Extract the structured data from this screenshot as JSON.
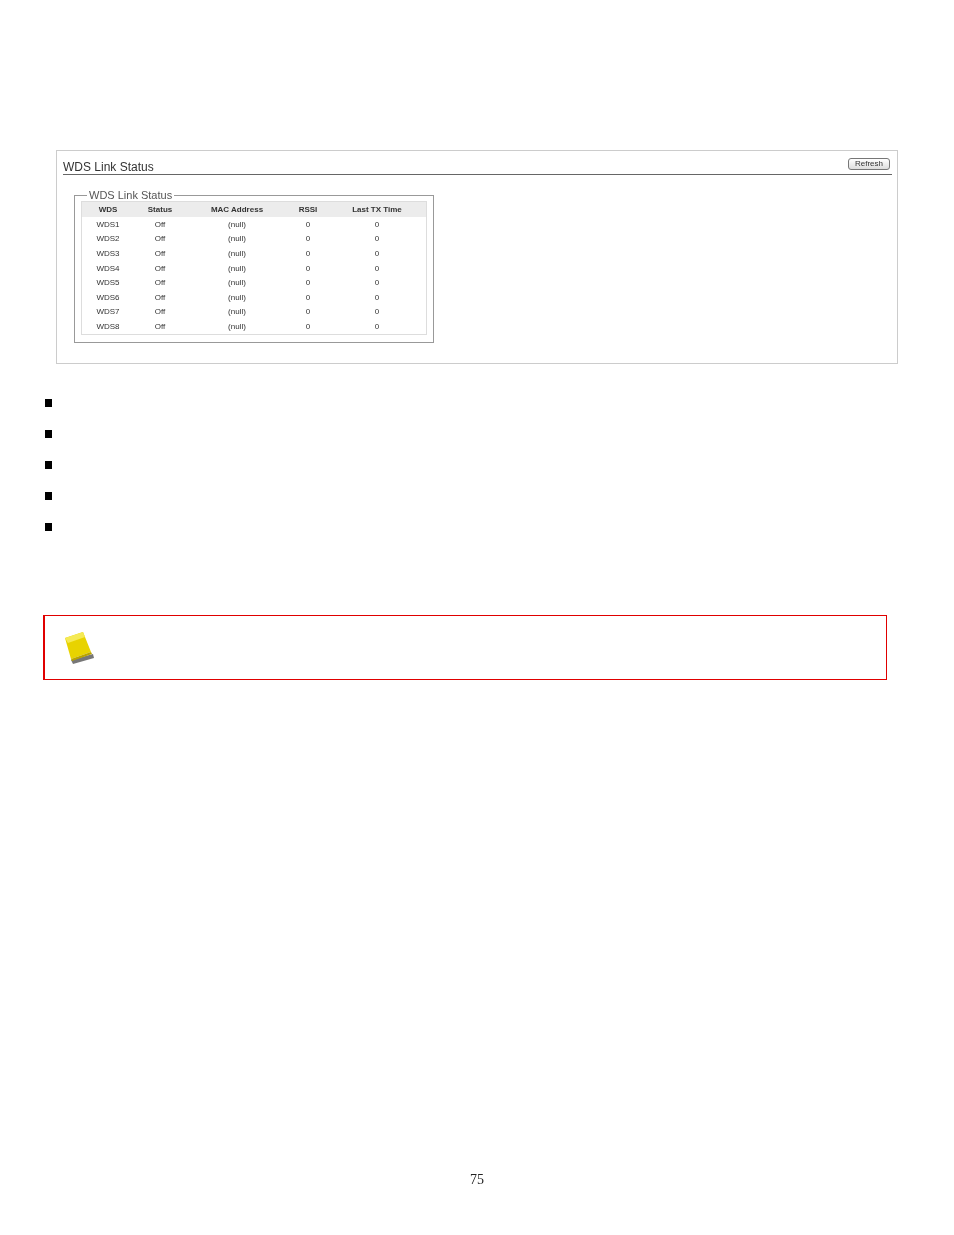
{
  "panel": {
    "title": "WDS Link Status",
    "refresh_button": "Refresh",
    "group": {
      "legend": "WDS Link Status",
      "table": {
        "columns": [
          "WDS",
          "Status",
          "MAC Address",
          "RSSI",
          "Last TX Time"
        ],
        "rows": [
          [
            "WDS1",
            "Off",
            "(null)",
            "0",
            "0"
          ],
          [
            "WDS2",
            "Off",
            "(null)",
            "0",
            "0"
          ],
          [
            "WDS3",
            "Off",
            "(null)",
            "0",
            "0"
          ],
          [
            "WDS4",
            "Off",
            "(null)",
            "0",
            "0"
          ],
          [
            "WDS5",
            "Off",
            "(null)",
            "0",
            "0"
          ],
          [
            "WDS6",
            "Off",
            "(null)",
            "0",
            "0"
          ],
          [
            "WDS7",
            "Off",
            "(null)",
            "0",
            "0"
          ],
          [
            "WDS8",
            "Off",
            "(null)",
            "0",
            "0"
          ]
        ]
      }
    }
  },
  "bullets": [
    {
      "kind": "square"
    },
    {
      "kind": "square"
    },
    {
      "kind": "square"
    },
    {
      "kind": "square"
    },
    {
      "kind": "square"
    }
  ],
  "callouts": [
    {
      "kind": "note"
    }
  ],
  "page_number": "75"
}
